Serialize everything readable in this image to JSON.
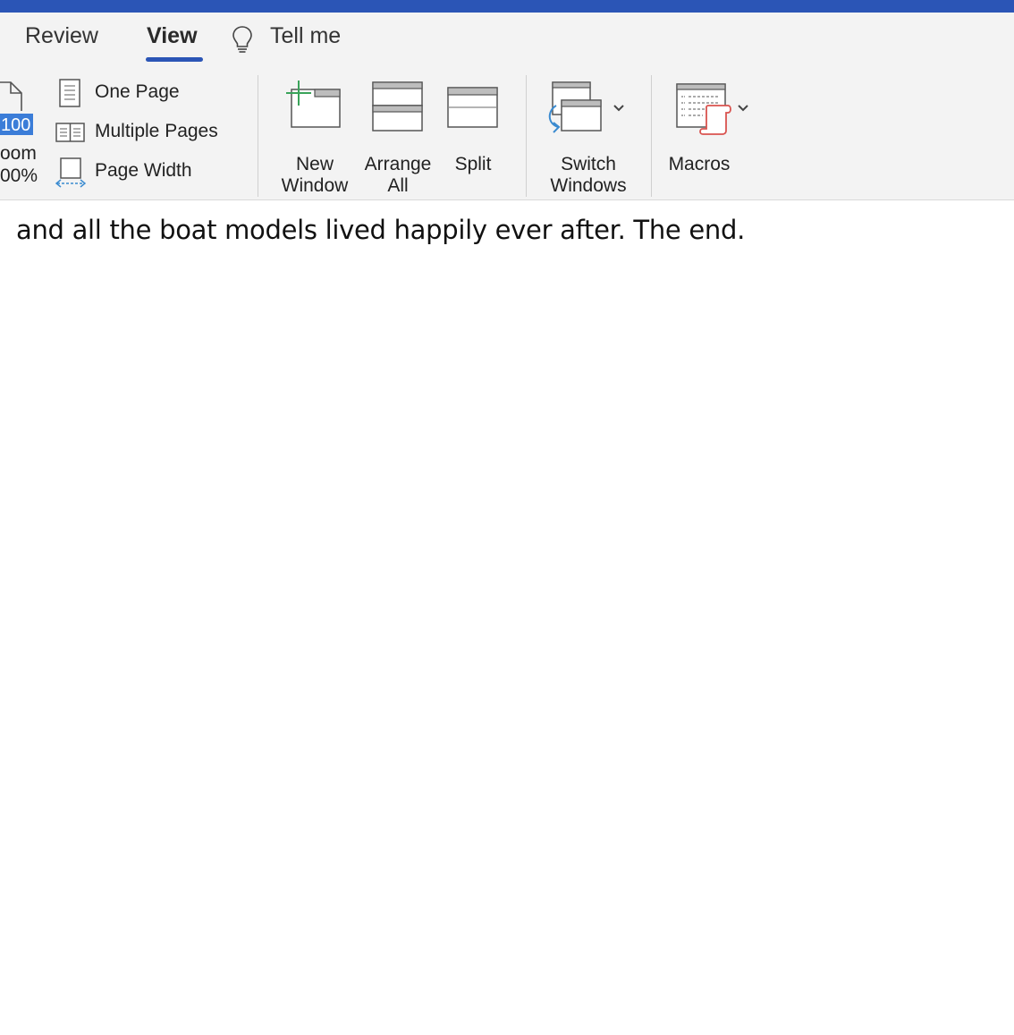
{
  "ribbon": {
    "tabs": {
      "review": "Review",
      "view": "View",
      "tell_me": "Tell me"
    },
    "zoom": {
      "value_badge": "100",
      "label_line1": "oom",
      "label_line2": "00%"
    },
    "page_views": {
      "one_page": "One Page",
      "multiple_pages": "Multiple Pages",
      "page_width": "Page Width"
    },
    "window_group": {
      "new_window_line1": "New",
      "new_window_line2": "Window",
      "arrange_all_line1": "Arrange",
      "arrange_all_line2": "All",
      "split": "Split",
      "switch_windows_line1": "Switch",
      "switch_windows_line2": "Windows"
    },
    "macros": "Macros"
  },
  "document": {
    "text": "and all the boat models lived happily ever after. The end."
  },
  "colors": {
    "title_bar": "#2b55b6",
    "tab_underline": "#2b55b6",
    "zoom_badge": "#3b7dd8",
    "new_window_plus": "#3aa35a",
    "switch_arrow": "#3b8bd0",
    "macros_scroll": "#d9534f"
  },
  "icons": {
    "tell_me": "lightbulb-icon",
    "zoom": "zoom-page-icon",
    "one_page": "one-page-icon",
    "multiple_pages": "multiple-pages-icon",
    "page_width": "page-width-icon",
    "new_window": "new-window-icon",
    "arrange_all": "arrange-all-icon",
    "split": "split-icon",
    "switch_windows": "switch-windows-icon",
    "macros": "macros-icon"
  }
}
